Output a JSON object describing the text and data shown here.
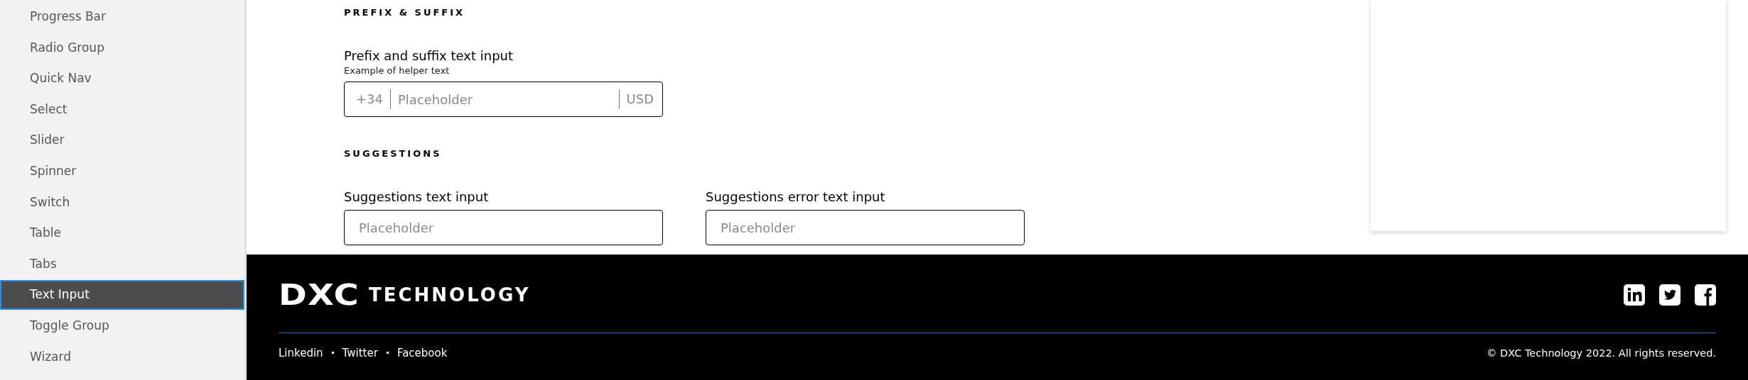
{
  "sidebar": {
    "items": [
      {
        "label": "Progress Bar",
        "selected": false
      },
      {
        "label": "Radio Group",
        "selected": false
      },
      {
        "label": "Quick Nav",
        "selected": false
      },
      {
        "label": "Select",
        "selected": false
      },
      {
        "label": "Slider",
        "selected": false
      },
      {
        "label": "Spinner",
        "selected": false
      },
      {
        "label": "Switch",
        "selected": false
      },
      {
        "label": "Table",
        "selected": false
      },
      {
        "label": "Tabs",
        "selected": false
      },
      {
        "label": "Text Input",
        "selected": true
      },
      {
        "label": "Toggle Group",
        "selected": false
      },
      {
        "label": "Wizard",
        "selected": false
      }
    ]
  },
  "sections": [
    {
      "heading": "PREFIX & SUFFIX",
      "fields": [
        {
          "label": "Prefix and suffix text input",
          "helper": "Example of helper text",
          "prefix": "+34",
          "placeholder": "Placeholder",
          "suffix": "USD"
        }
      ]
    },
    {
      "heading": "SUGGESTIONS",
      "fields": [
        {
          "label": "Suggestions text input",
          "placeholder": "Placeholder"
        },
        {
          "label": "Suggestions error text input",
          "placeholder": "Placeholder"
        }
      ]
    }
  ],
  "footer": {
    "logo_mark": "DXC",
    "logo_word": "TECHNOLOGY",
    "social": [
      {
        "kind": "linkedin"
      },
      {
        "kind": "twitter"
      },
      {
        "kind": "facebook"
      }
    ],
    "links": [
      "Linkedin",
      "Twitter",
      "Facebook"
    ],
    "copyright": "© DXC Technology 2022. All rights reserved."
  }
}
